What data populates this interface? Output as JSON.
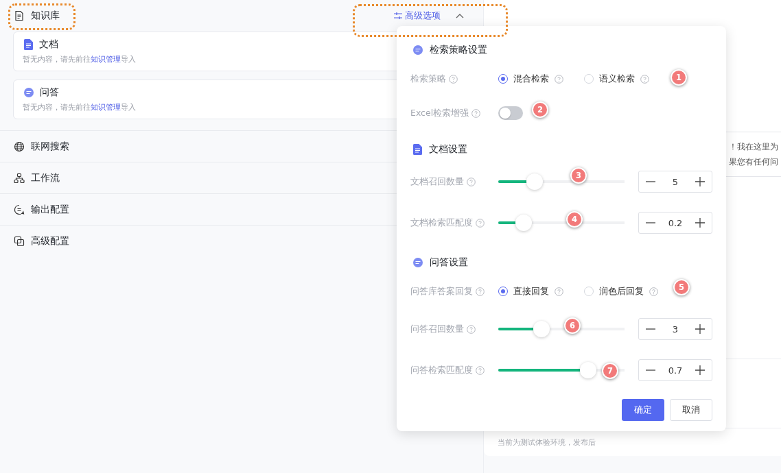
{
  "knowledge": {
    "title": "知识库",
    "advanced_toggle": {
      "label": "高级选项",
      "expanded": true
    },
    "cards": [
      {
        "kind": "doc",
        "title": "文档",
        "hint_before": "暂无内容，请先前往",
        "hint_link": "知识管理",
        "hint_after": "导入"
      },
      {
        "kind": "qa",
        "title": "问答",
        "hint_before": "暂无内容，请先前往",
        "hint_link": "知识管理",
        "hint_after": "导入"
      }
    ],
    "sections": [
      {
        "kind": "globe",
        "label": "联网搜索"
      },
      {
        "kind": "workflow",
        "label": "工作流"
      },
      {
        "kind": "output",
        "label": "输出配置"
      },
      {
        "kind": "advanced",
        "label": "高级配置"
      }
    ]
  },
  "chat": {
    "bubble_lines": [
      "！我在这里为",
      "果您有任何问"
    ],
    "footer_note": "当前为测试体验环境，发布后"
  },
  "advanced_popover": {
    "sections": [
      {
        "kind": "qa",
        "title": "检索策略设置",
        "rows": [
          {
            "kind": "radio",
            "label": "检索策略",
            "options": [
              {
                "label": "混合检索",
                "selected": true
              },
              {
                "label": "语义检索",
                "selected": false
              }
            ]
          },
          {
            "kind": "switch",
            "label": "Excel检索增强",
            "on": false
          }
        ]
      },
      {
        "kind": "doc",
        "title": "文档设置",
        "rows": [
          {
            "kind": "slider",
            "label": "文档召回数量",
            "level": 0.29,
            "value": "5"
          },
          {
            "kind": "slider",
            "label": "文档检索匹配度",
            "level": 0.2,
            "value": "0.2"
          }
        ]
      },
      {
        "kind": "qa",
        "title": "问答设置",
        "rows": [
          {
            "kind": "radio",
            "label": "问答库答案回复",
            "options": [
              {
                "label": "直接回复",
                "selected": true
              },
              {
                "label": "润色后回复",
                "selected": false
              }
            ]
          },
          {
            "kind": "slider",
            "label": "问答召回数量",
            "level": 0.34,
            "value": "3"
          },
          {
            "kind": "slider",
            "label": "问答检索匹配度",
            "level": 0.71,
            "value": "0.7"
          }
        ]
      }
    ],
    "buttons": [
      {
        "kind": "primary",
        "label": "确定"
      },
      {
        "kind": "default",
        "label": "取消"
      }
    ]
  },
  "annotations": [
    {
      "label": "1"
    },
    {
      "label": "2"
    },
    {
      "label": "3"
    },
    {
      "label": "4"
    },
    {
      "label": "5"
    },
    {
      "label": "6"
    },
    {
      "label": "7"
    }
  ]
}
